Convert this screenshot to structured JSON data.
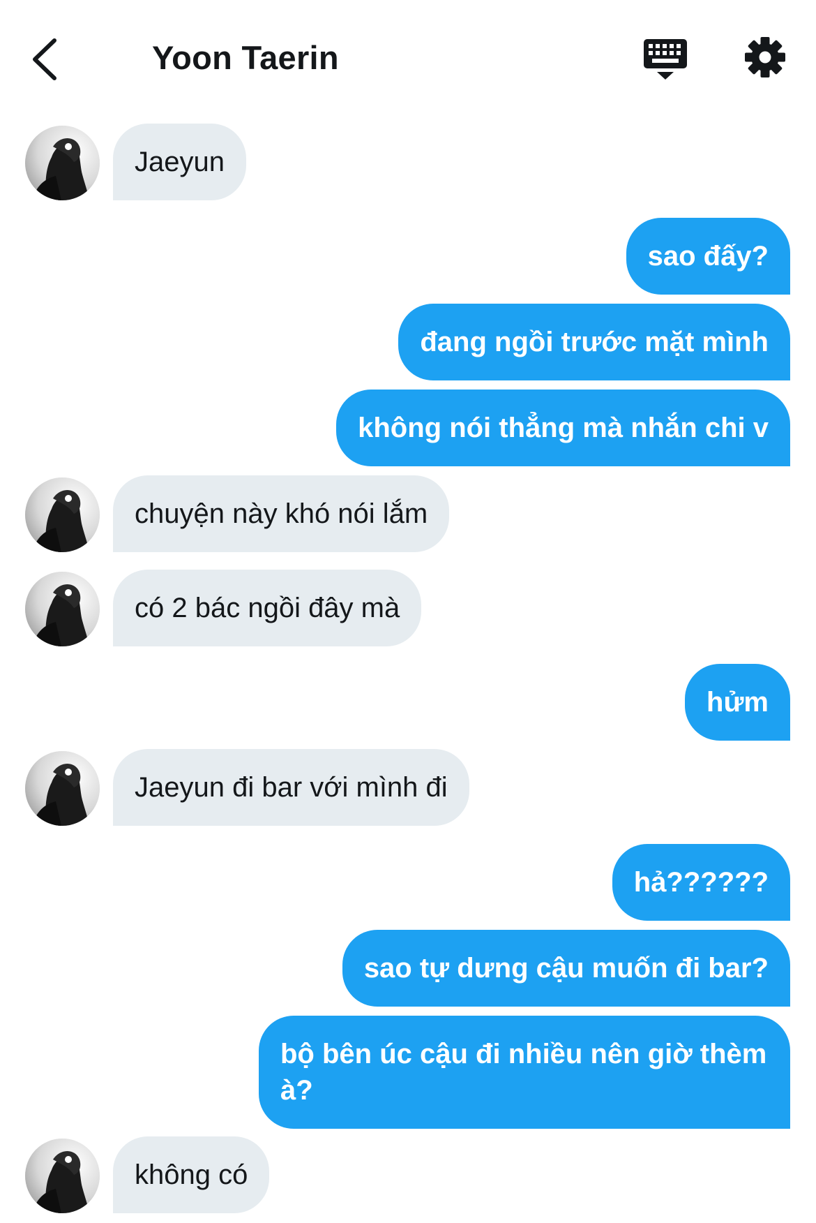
{
  "header": {
    "back_icon": "chevron-left-icon",
    "title": "Yoon Taerin",
    "keyboard_icon": "keyboard-icon",
    "settings_icon": "gear-icon"
  },
  "colors": {
    "incoming_bubble": "#e6ecf0",
    "outgoing_bubble": "#1da1f2",
    "text_dark": "#14171a"
  },
  "messages": [
    {
      "from": "them",
      "text": "Jaeyun"
    },
    {
      "from": "me",
      "text": "sao đấy?"
    },
    {
      "from": "me",
      "text": "đang ngồi trước mặt mình"
    },
    {
      "from": "me",
      "text": "không nói thẳng mà nhắn chi v"
    },
    {
      "from": "them",
      "text": "chuyện này khó nói lắm"
    },
    {
      "from": "them",
      "text": "có 2 bác ngồi đây mà"
    },
    {
      "from": "me",
      "text": "hửm"
    },
    {
      "from": "them",
      "text": "Jaeyun đi bar với mình đi"
    },
    {
      "from": "me",
      "text": "hả??????"
    },
    {
      "from": "me",
      "text": "sao tự dưng cậu muốn đi bar?"
    },
    {
      "from": "me",
      "text": "bộ bên úc cậu đi nhiều nên giờ thèm à?"
    },
    {
      "from": "them",
      "text": "không có"
    }
  ]
}
